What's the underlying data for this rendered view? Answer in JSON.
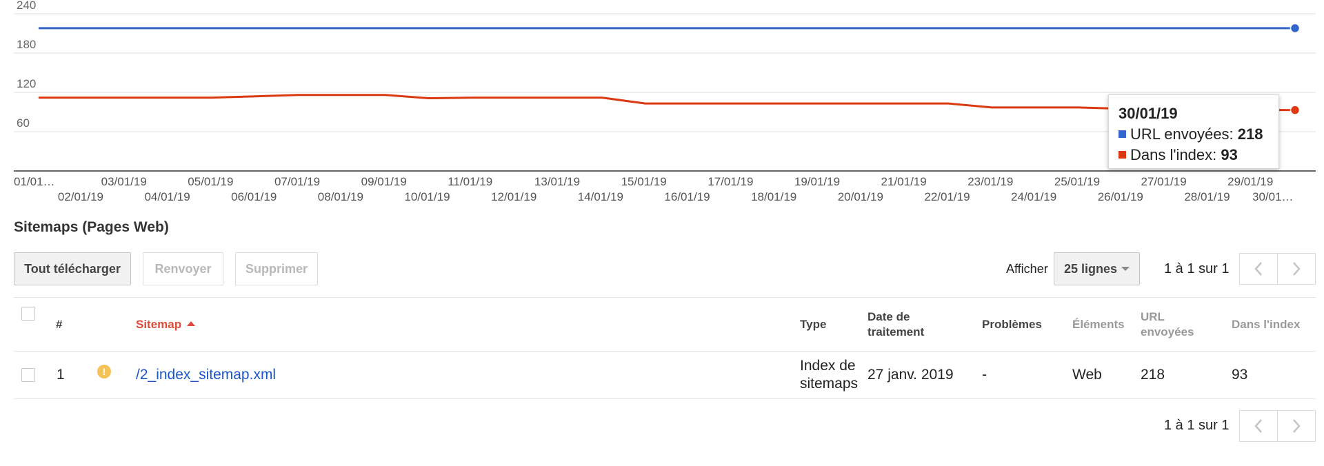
{
  "chart_data": {
    "type": "line",
    "x": [
      "01/01/19",
      "02/01/19",
      "03/01/19",
      "04/01/19",
      "05/01/19",
      "06/01/19",
      "07/01/19",
      "08/01/19",
      "09/01/19",
      "10/01/19",
      "11/01/19",
      "12/01/19",
      "13/01/19",
      "14/01/19",
      "15/01/19",
      "16/01/19",
      "17/01/19",
      "18/01/19",
      "19/01/19",
      "20/01/19",
      "21/01/19",
      "22/01/19",
      "23/01/19",
      "24/01/19",
      "25/01/19",
      "26/01/19",
      "27/01/19",
      "28/01/19",
      "29/01/19",
      "30/01/19"
    ],
    "tick_labels": [
      "01/01…",
      "02/01/19",
      "03/01/19",
      "04/01/19",
      "05/01/19",
      "06/01/19",
      "07/01/19",
      "08/01/19",
      "09/01/19",
      "10/01/19",
      "11/01/19",
      "12/01/19",
      "13/01/19",
      "14/01/19",
      "15/01/19",
      "16/01/19",
      "17/01/19",
      "18/01/19",
      "19/01/19",
      "20/01/19",
      "21/01/19",
      "22/01/19",
      "23/01/19",
      "24/01/19",
      "25/01/19",
      "26/01/19",
      "27/01/19",
      "28/01/19",
      "29/01/19",
      "30/01…"
    ],
    "y_ticks": [
      60,
      120,
      180,
      240
    ],
    "ylim": [
      0,
      240
    ],
    "grid": true,
    "series": [
      {
        "name": "URL envoyées",
        "color": "#3366cc",
        "values": [
          218,
          218,
          218,
          218,
          218,
          218,
          218,
          218,
          218,
          218,
          218,
          218,
          218,
          218,
          218,
          218,
          218,
          218,
          218,
          218,
          218,
          218,
          218,
          218,
          218,
          218,
          218,
          218,
          218,
          218
        ]
      },
      {
        "name": "Dans l'index",
        "color": "#dc3912",
        "values": [
          112,
          112,
          112,
          112,
          112,
          114,
          116,
          116,
          116,
          111,
          112,
          112,
          112,
          112,
          103,
          103,
          103,
          103,
          103,
          103,
          103,
          103,
          97,
          97,
          97,
          95,
          94,
          93,
          93,
          93
        ]
      }
    ],
    "tooltip": {
      "date": "30/01/19",
      "label_sent": "URL envoyées:",
      "value_sent": "218",
      "label_index": "Dans l'index:",
      "value_index": "93"
    }
  },
  "section_title": "Sitemaps (Pages Web)",
  "toolbar": {
    "download_label": "Tout télécharger",
    "resend_label": "Renvoyer",
    "delete_label": "Supprimer"
  },
  "pagination": {
    "show_label": "Afficher",
    "rows_value": "25 lignes",
    "range_text": "1 à 1 sur 1"
  },
  "table": {
    "headers": {
      "num": "#",
      "sitemap": "Sitemap",
      "type": "Type",
      "date_1": "Date de",
      "date_2": "traitement",
      "problems": "Problèmes",
      "elements": "Éléments",
      "sent_1": "URL",
      "sent_2": "envoyées",
      "index": "Dans l'index"
    },
    "rows": [
      {
        "num": "1",
        "sitemap": "/2_index_sitemap.xml",
        "type_1": "Index de",
        "type_2": "sitemaps",
        "date": "27 janv. 2019",
        "problems": "-",
        "elements": "Web",
        "sent": "218",
        "index": "93"
      }
    ]
  },
  "colors": {
    "blue": "#3366cc",
    "red": "#dc3912",
    "warning": "#f4c256",
    "link": "#1a56c8",
    "sort": "#dd4b39"
  }
}
